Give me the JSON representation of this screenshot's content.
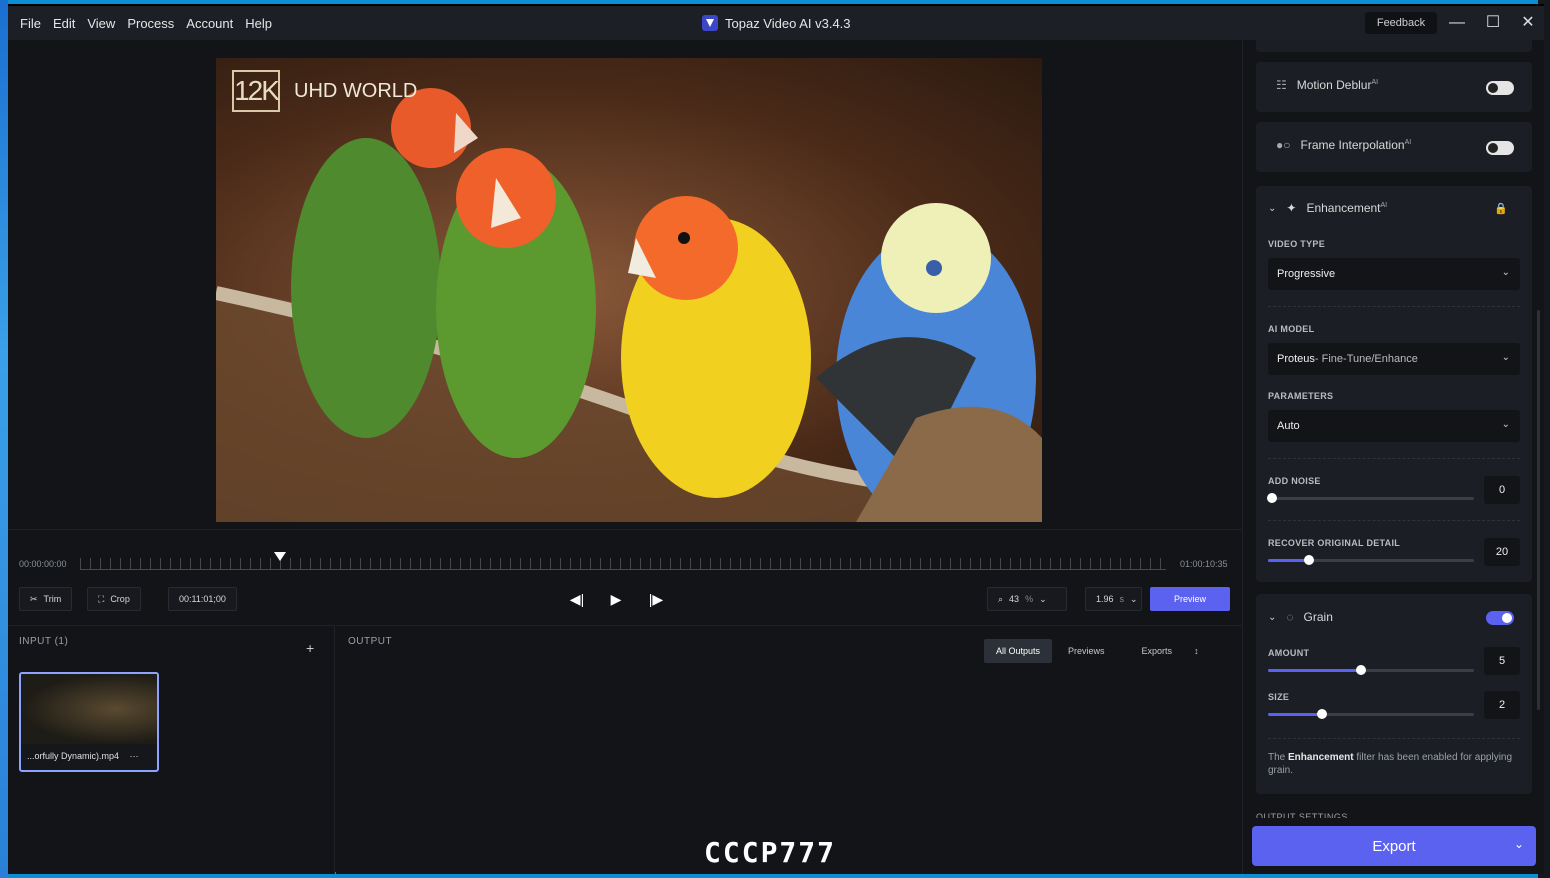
{
  "menu": [
    "File",
    "Edit",
    "View",
    "Process",
    "Account",
    "Help"
  ],
  "app_title": "Topaz Video AI  v3.4.3",
  "feedback": "Feedback",
  "window": {
    "minimize": "—",
    "maximize": "☐",
    "close": "✕"
  },
  "watermark": {
    "badge": "12K",
    "text": "UHD WORLD"
  },
  "timeline": {
    "start": "00:00:00:00",
    "end": "01:00:10:35",
    "trim": "Trim",
    "crop": "Crop",
    "time": "00:11:01;00",
    "zoom": "43",
    "zoom_unit": "%",
    "duration": "1.96",
    "duration_unit": "s",
    "preview": "Preview"
  },
  "input": {
    "label": "INPUT (1)",
    "add": "+",
    "file": "...orfully Dynamic).mp4",
    "more": "···"
  },
  "output": {
    "label": "OUTPUT",
    "tabs": [
      "All Outputs",
      "Previews",
      "Exports"
    ],
    "overlay": "CCCP777"
  },
  "side": {
    "motion_deblur": "Motion Deblur",
    "frame_interp": "Frame Interpolation",
    "ai_sup": "AI",
    "enhancement": "Enhancement",
    "video_type_label": "VIDEO TYPE",
    "video_type": "Progressive",
    "ai_model_label": "AI MODEL",
    "ai_model_bold": "Proteus",
    "ai_model_rest": " - Fine-Tune/Enhance",
    "params_label": "PARAMETERS",
    "params": "Auto",
    "add_noise_label": "ADD NOISE",
    "add_noise": "0",
    "recover_label": "RECOVER ORIGINAL DETAIL",
    "recover": "20",
    "grain": "Grain",
    "amount_label": "AMOUNT",
    "amount": "5",
    "size_label": "SIZE",
    "size": "2",
    "note_pre": "The ",
    "note_bold": "Enhancement",
    "note_post": " filter has been enabled for applying grain.",
    "output_settings": "OUTPUT SETTINGS",
    "export": "Export"
  },
  "levels": {
    "add_noise": 0.02,
    "recover": 0.2,
    "amount": 0.45,
    "size": 0.26
  },
  "colors": {
    "accent": "#5b62f0",
    "bg": "#121418",
    "card": "#1b1e24"
  }
}
